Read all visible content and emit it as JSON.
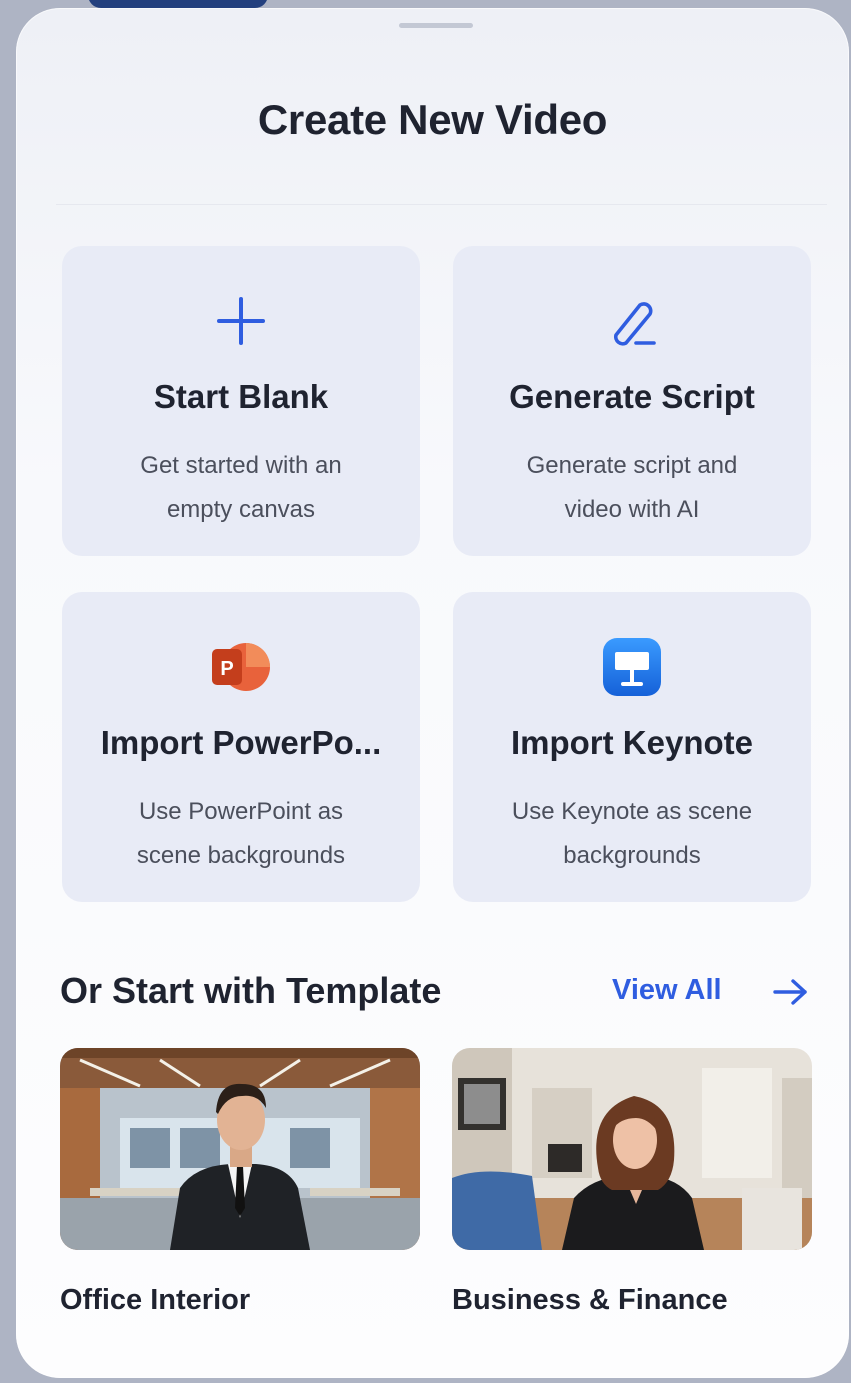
{
  "sheet": {
    "title": "Create New Video"
  },
  "actions": [
    {
      "title": "Start Blank",
      "desc_line1": "Get started with an",
      "desc_line2": "empty canvas",
      "icon": "plus-icon"
    },
    {
      "title": "Generate Script",
      "desc_line1": "Generate script and",
      "desc_line2": "video with AI",
      "icon": "pen-icon"
    },
    {
      "title": "Import PowerPo...",
      "desc_line1": "Use PowerPoint as",
      "desc_line2": "scene backgrounds",
      "icon": "powerpoint-icon"
    },
    {
      "title": "Import Keynote",
      "desc_line1": "Use Keynote as scene",
      "desc_line2": "backgrounds",
      "icon": "keynote-icon"
    }
  ],
  "templates": {
    "section_title": "Or Start with Template",
    "view_all_label": "View All",
    "items": [
      {
        "name": "Office Interior"
      },
      {
        "name": "Business & Finance"
      }
    ]
  },
  "colors": {
    "accent": "#2f5de0",
    "card_bg": "#e8ebf6",
    "title_text": "#1f2330",
    "powerpoint": "#d24726",
    "keynote": "#1e73e8"
  }
}
